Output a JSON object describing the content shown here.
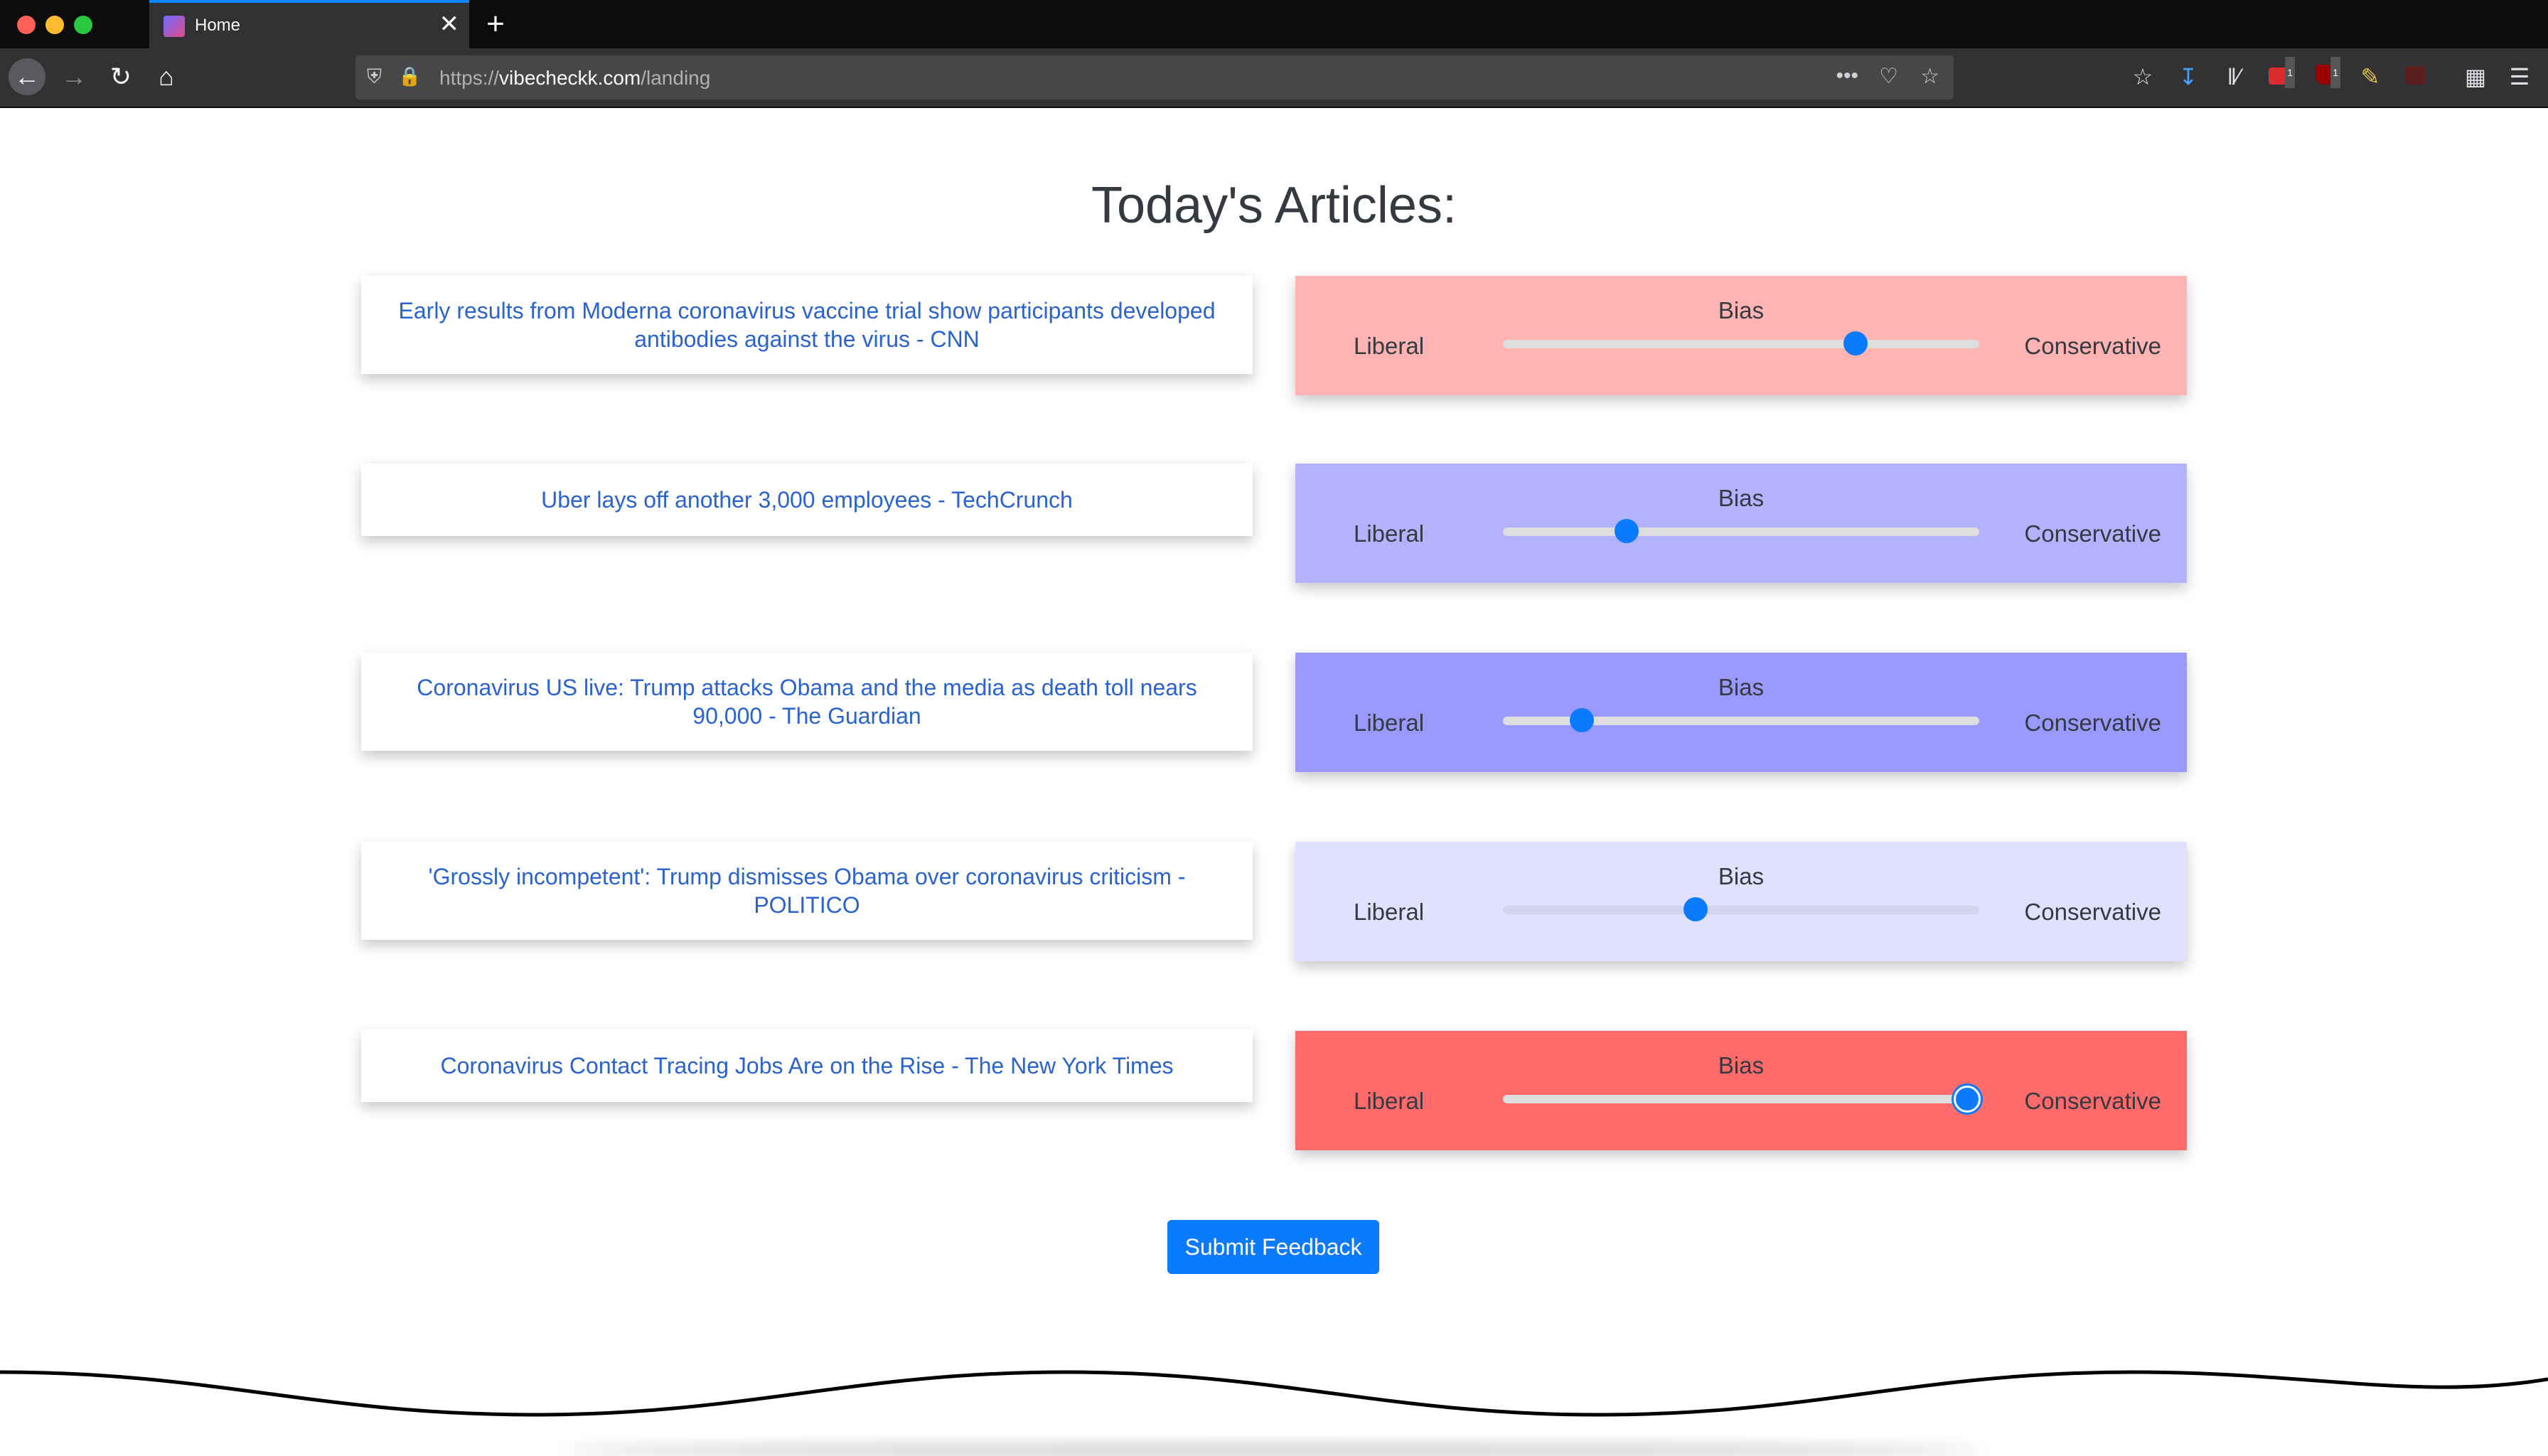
{
  "browser": {
    "tab_title": "Home",
    "tab_close": "✕",
    "new_tab": "+",
    "url_prefix": "https://",
    "url_host": "vibecheckk.com",
    "url_path": "/landing",
    "toolbar_icons": [
      "reader-list-icon",
      "download-icon",
      "library-icon",
      "extension-red-icon",
      "ublock-icon",
      "pencil-icon",
      "extension-dark-icon",
      "extensions-icon",
      "menu-icon"
    ],
    "badge_count": "1"
  },
  "page": {
    "title": "Today's Articles:",
    "bias_label": "Bias",
    "left_label": "Liberal",
    "right_label": "Conservative",
    "submit_label": "Submit Feedback"
  },
  "articles": [
    {
      "title": "Early results from Moderna coronavirus vaccine trial show participants developed antibodies against the virus - CNN",
      "bias": 0.74,
      "color": "#ffb3b3"
    },
    {
      "title": "Uber lays off another 3,000 employees - TechCrunch",
      "bias": 0.26,
      "color": "#b3b3ff"
    },
    {
      "title": "Coronavirus US live: Trump attacks Obama and the media as death toll nears 90,000 - The Guardian",
      "bias": 0.165,
      "color": "#9999ff"
    },
    {
      "title": "'Grossly incompetent': Trump dismisses Obama over coronavirus criticism - POLITICO",
      "bias": 0.405,
      "color": "#e1e1ff"
    },
    {
      "title": "Coronavirus Contact Tracing Jobs Are on the Rise - The New York Times",
      "bias": 0.975,
      "color": "#ff6b6b"
    }
  ]
}
